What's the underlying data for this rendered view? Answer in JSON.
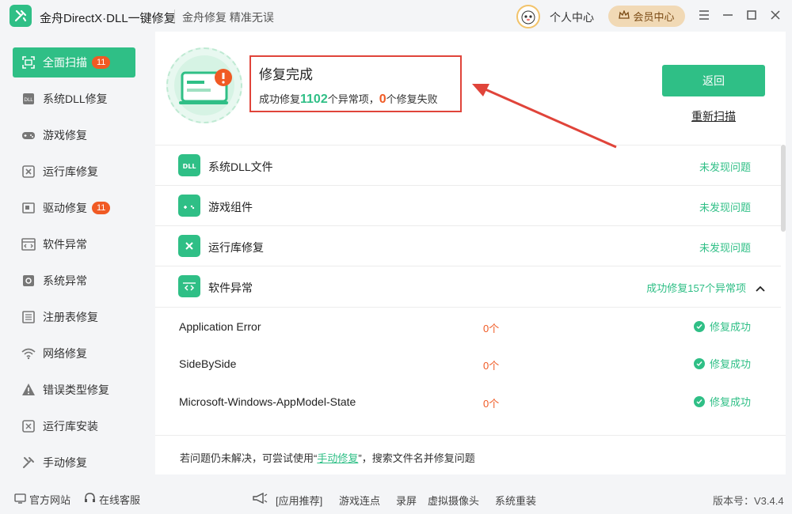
{
  "titlebar": {
    "app_title": "金舟DirectX·DLL一键修复",
    "app_subtitle": "金舟修复 精准无误",
    "user_center": "个人中心",
    "vip_center": "会员中心"
  },
  "sidebar": {
    "items": [
      {
        "label": "全面扫描",
        "badge": "11",
        "icon": "scan-icon"
      },
      {
        "label": "系统DLL修复",
        "icon": "dll-icon"
      },
      {
        "label": "游戏修复",
        "icon": "gamepad-icon"
      },
      {
        "label": "运行库修复",
        "icon": "runtime-icon"
      },
      {
        "label": "驱动修复",
        "badge": "11",
        "icon": "driver-icon"
      },
      {
        "label": "软件异常",
        "icon": "code-icon"
      },
      {
        "label": "系统异常",
        "icon": "gear-icon"
      },
      {
        "label": "注册表修复",
        "icon": "list-icon"
      },
      {
        "label": "网络修复",
        "icon": "wifi-icon"
      },
      {
        "label": "错误类型修复",
        "icon": "warning-icon"
      },
      {
        "label": "运行库安装",
        "icon": "install-icon"
      },
      {
        "label": "手动修复",
        "icon": "wrench-icon"
      }
    ]
  },
  "result": {
    "title": "修复完成",
    "desc_prefix": "成功修复",
    "success_count": "1102",
    "desc_mid": "个异常项，",
    "fail_count": "0",
    "desc_suffix": "个修复失败",
    "back_label": "返回",
    "rescan_label": "重新扫描"
  },
  "categories": [
    {
      "name": "系统DLL文件",
      "status": "未发现问题",
      "icon": "dll-icon"
    },
    {
      "name": "游戏组件",
      "status": "未发现问题",
      "icon": "gamepad-icon"
    },
    {
      "name": "运行库修复",
      "status": "未发现问题",
      "icon": "runtime-icon"
    },
    {
      "name": "软件异常",
      "status": "成功修复157个异常项",
      "icon": "code-icon"
    }
  ],
  "sub_items": [
    {
      "name": "Application Error",
      "count": "0个",
      "status": "修复成功"
    },
    {
      "name": "SideBySide",
      "count": "0个",
      "status": "修复成功"
    },
    {
      "name": "Microsoft-Windows-AppModel-State",
      "count": "0个",
      "status": "修复成功"
    }
  ],
  "footer_tip": {
    "prefix": "若问题仍未解决，可尝试使用“",
    "link": "手动修复",
    "suffix": "”，搜索文件名并修复问题"
  },
  "bottombar": {
    "website": "官方网站",
    "service": "在线客服",
    "recommend": "[应用推荐]",
    "links": [
      "游戏连点",
      "录屏",
      "虚拟摄像头",
      "系统重装"
    ],
    "version": "版本号：V3.4.4"
  },
  "colors": {
    "accent": "#2fbf86",
    "warn": "#f05a24",
    "highlight_border": "#e0443a"
  }
}
